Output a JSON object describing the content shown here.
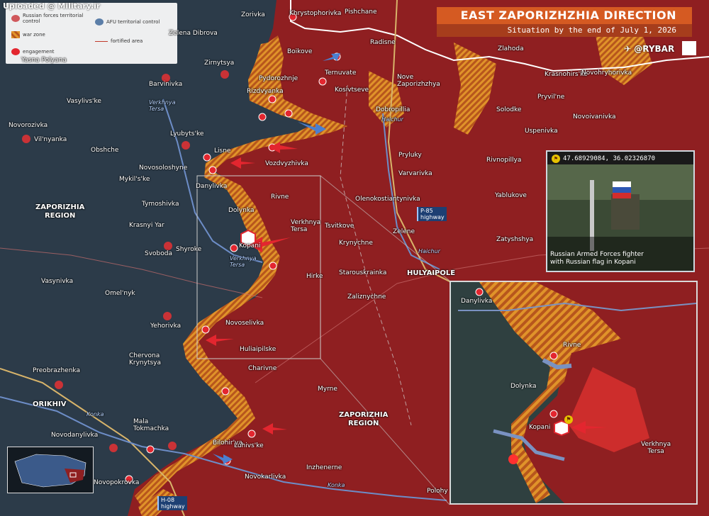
{
  "watermark": "Uploaded @ Military.ir",
  "header": {
    "title": "EAST ZAPORIZHZHIA DIRECTION",
    "subtitle": "Situation by the end of July 1, 2026",
    "brand": "@RYBAR"
  },
  "legend": {
    "russian": "Russian forces territorial control",
    "afu": "AFU territorial control",
    "warzone": "war zone",
    "fortified": "fortified area",
    "engagement": "engagement"
  },
  "colors": {
    "russian": "#8f1f21",
    "afu": "#2c3b49",
    "warzone": "#e0932a",
    "engagement": "#e3262f",
    "accent": "#d55a22"
  },
  "regions": {
    "west": "ZAPORIZHIA\nREGION",
    "east": "ZAPORIZHIA\nREGION"
  },
  "rivers": {
    "verkhnya_tersa_1": "Verkhnya\nTersa",
    "verkhnya_tersa_2": "Verkhnya\nTersa",
    "haichur_1": "Haichur",
    "haichur_2": "Haichur",
    "konka_1": "Konka",
    "konka_2": "Konka"
  },
  "highways": {
    "p85": "P-85\nhighway",
    "h08": "H-08\nhighway"
  },
  "towns": {
    "hulyaipole": "HULYAIPOLE",
    "orikhiv": "ORIKHIV",
    "preobrazhenka": "Preobrazhenka"
  },
  "settlements": [
    "Zorivka",
    "Khrystophorivka",
    "Pishchane",
    "Zelena Dibrova",
    "Zirnytsya",
    "Boikove",
    "Radisne",
    "Zlahoda",
    "Yasna Polyana",
    "Barvinivka",
    "Ternuvate",
    "Pydorozhnje",
    "Nove\nZaporizhzhya",
    "Krasnohirs'ke",
    "Novohryhorivka",
    "Vasylivs'ke",
    "Rizdvyanka",
    "Kosivtseve",
    "Pryvil'ne",
    "Novoivanivka",
    "Novorozivka",
    "Dobropillia",
    "Solodke",
    "Vil'nyanka",
    "Lyubyts'ke",
    "Uspenivka",
    "Obshche",
    "Lisne",
    "Pryluky",
    "Novosoloshyne",
    "Vozdvyzhivka",
    "Rivnopillya",
    "Varvarivka",
    "Mykil's'ke",
    "Danylivka",
    "Yablukove",
    "Rivne",
    "Olenokostiantynivka",
    "Tymoshivka",
    "Dolynka",
    "Krasnyi Yar",
    "Verkhnya\nTersa",
    "Tsvitkove",
    "Zelene",
    "Zatyshshya",
    "Kopani",
    "Shyroke",
    "Krynychne",
    "Svoboda",
    "Hirke",
    "Starouskrainka",
    "Vasynivka",
    "Zaliznychne",
    "Omel'nyk",
    "Yehorivka",
    "Novoselivka",
    "Huliaipilske",
    "Chervona\nKrynytsya",
    "Charivne",
    "Myrne",
    "Mala\nTokmachka",
    "Novodanylivka",
    "Bilohir'ya",
    "Luhivs'ke",
    "Inzhenerne",
    "Novopokrovka",
    "Novokarlivka",
    "Polohy"
  ],
  "photo": {
    "coords": "47.68929084, 36.02326870",
    "caption": "Russian Armed Forces fighter\nwith Russian flag in Kopani"
  },
  "inset": {
    "danylivka": "Danylivka",
    "rivne": "Rivne",
    "dolynka": "Dolynka",
    "kopani": "Kopani",
    "verkhnya_tersa": "Verkhnya\nTersa"
  }
}
